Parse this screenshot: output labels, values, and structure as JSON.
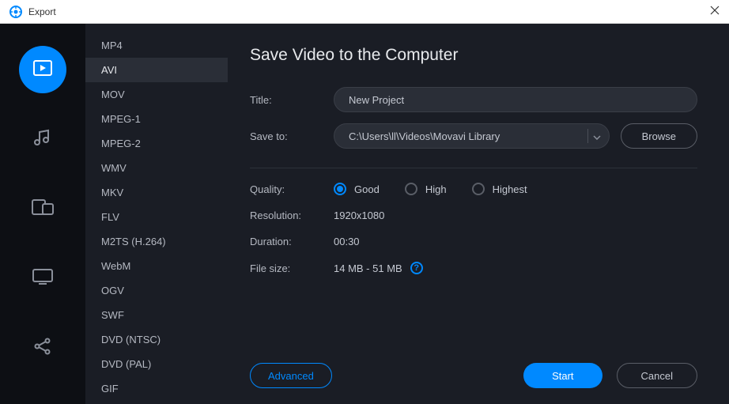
{
  "titlebar": {
    "title": "Export"
  },
  "rail": {
    "items": [
      {
        "name": "video",
        "active": true
      },
      {
        "name": "audio",
        "active": false
      },
      {
        "name": "devices",
        "active": false
      },
      {
        "name": "tv",
        "active": false
      },
      {
        "name": "share",
        "active": false
      }
    ]
  },
  "formats": [
    "MP4",
    "AVI",
    "MOV",
    "MPEG-1",
    "MPEG-2",
    "WMV",
    "MKV",
    "FLV",
    "M2TS (H.264)",
    "WebM",
    "OGV",
    "SWF",
    "DVD (NTSC)",
    "DVD (PAL)",
    "GIF"
  ],
  "formats_selected_index": 1,
  "content": {
    "heading": "Save Video to the Computer",
    "title_label": "Title:",
    "title_value": "New Project",
    "saveto_label": "Save to:",
    "saveto_value": "C:\\Users\\ll\\Videos\\Movavi Library",
    "browse_label": "Browse",
    "quality_label": "Quality:",
    "quality_options": [
      "Good",
      "High",
      "Highest"
    ],
    "quality_selected_index": 0,
    "resolution_label": "Resolution:",
    "resolution_value": "1920x1080",
    "duration_label": "Duration:",
    "duration_value": "00:30",
    "filesize_label": "File size:",
    "filesize_value": "14 MB - 51 MB"
  },
  "footer": {
    "advanced_label": "Advanced",
    "start_label": "Start",
    "cancel_label": "Cancel"
  }
}
